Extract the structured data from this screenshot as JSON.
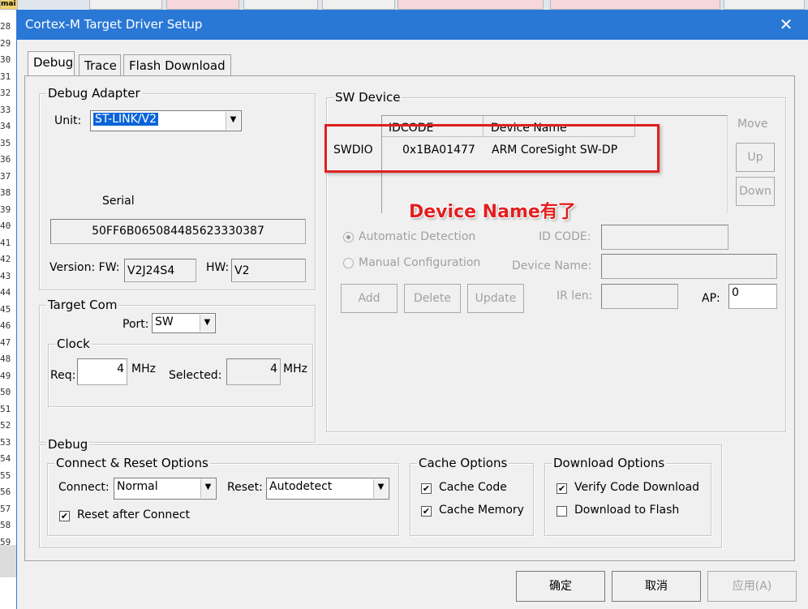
{
  "background": {
    "corner_tab_label": "mai",
    "line_numbers": [
      "28",
      "29",
      "30",
      "31",
      "32",
      "33",
      "34",
      "35",
      "36",
      "37",
      "38",
      "39",
      "40",
      "41",
      "42",
      "43",
      "44",
      "45",
      "46",
      "47",
      "48",
      "49",
      "50",
      "51",
      "52",
      "53",
      "54",
      "55",
      "56",
      "57",
      "58",
      "59"
    ]
  },
  "dialog": {
    "title": "Cortex-M Target Driver Setup",
    "close_glyph": "✕",
    "tabs": [
      {
        "label": "Debug",
        "active": true
      },
      {
        "label": "Trace",
        "active": false
      },
      {
        "label": "Flash Download",
        "active": false
      }
    ]
  },
  "debug_adapter": {
    "title": "Debug Adapter",
    "unit_label": "Unit:",
    "unit_value": "ST-LINK/V2",
    "serial_label": "Serial",
    "serial_value": "50FF6B065084485623330387",
    "version_label": "Version: FW:",
    "fw_value": "V2J24S4",
    "hw_label": "HW:",
    "hw_value": "V2"
  },
  "target_com": {
    "title": "Target Com",
    "port_label": "Port:",
    "port_value": "SW",
    "clock_title": "Clock",
    "req_label": "Req:",
    "req_value": "4",
    "req_unit": "MHz",
    "selected_label": "Selected:",
    "selected_value": "4",
    "selected_unit": "MHz"
  },
  "sw_device": {
    "title": "SW Device",
    "headers": {
      "idcode": "IDCODE",
      "device_name": "Device Name"
    },
    "rows": [
      {
        "port": "SWDIO",
        "idcode": "0x1BA01477",
        "device_name": "ARM CoreSight SW-DP"
      }
    ],
    "move_label": "Move",
    "up_label": "Up",
    "down_label": "Down",
    "annotation": "Device Name有了",
    "auto_detect_label": "Automatic Detection",
    "manual_config_label": "Manual Configuration",
    "id_code_label": "ID CODE:",
    "device_name_label": "Device Name:",
    "ir_len_label": "IR len:",
    "ap_label": "AP:",
    "ap_value": "0",
    "add_label": "Add",
    "delete_label": "Delete",
    "update_label": "Update",
    "annotation_color": "#e02020"
  },
  "debug_group": {
    "title": "Debug",
    "connect_reset": {
      "title": "Connect & Reset Options",
      "connect_label": "Connect:",
      "connect_value": "Normal",
      "reset_label": "Reset:",
      "reset_value": "Autodetect",
      "reset_after_connect_label": "Reset after Connect",
      "reset_after_connect": true
    },
    "cache": {
      "title": "Cache Options",
      "cache_code_label": "Cache Code",
      "cache_code": true,
      "cache_memory_label": "Cache Memory",
      "cache_memory": true
    },
    "download": {
      "title": "Download Options",
      "verify_label": "Verify Code Download",
      "verify": true,
      "flash_label": "Download to Flash",
      "flash": false
    }
  },
  "footer": {
    "ok_label": "确定",
    "cancel_label": "取消",
    "apply_label": "应用(A)"
  },
  "check_glyph": "✔",
  "combo_arrow_glyph": "▼"
}
